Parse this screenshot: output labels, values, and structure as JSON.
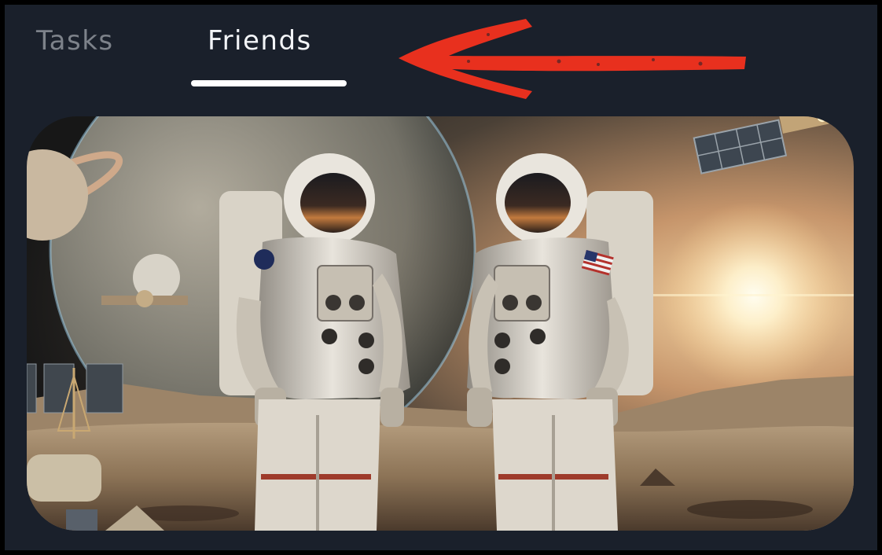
{
  "tabs": {
    "items": [
      {
        "label": "Tasks",
        "active": false
      },
      {
        "label": "Friends",
        "active": true
      }
    ],
    "active_color": "#f2f4f7",
    "inactive_color": "#7d828a",
    "indicator_color": "#ffffff"
  },
  "annotation": {
    "icon": "red-arrow-icon",
    "color": "#e8301e"
  },
  "banner": {
    "icon": "astronauts-illustration",
    "palette": {
      "sky_dark": "#171717",
      "sky_warm": "#c6956b",
      "ground": "#8c7356",
      "sun": "#fff3cf"
    }
  },
  "colors": {
    "background": "#1a202b",
    "frame": "#000000"
  }
}
